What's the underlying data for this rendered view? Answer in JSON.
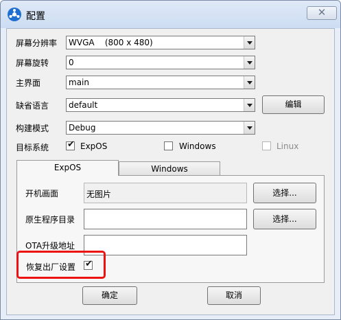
{
  "window": {
    "title": "配置",
    "close_glyph": "✕"
  },
  "form": {
    "resolution": {
      "label": "屏幕分辨率",
      "value": "WVGA    (800 x 480)"
    },
    "rotation": {
      "label": "屏幕旋转",
      "value": "0"
    },
    "main_ui": {
      "label": "主界面",
      "value": "main"
    },
    "language": {
      "label": "缺省语言",
      "value": "default",
      "edit_label": "编辑"
    },
    "build_mode": {
      "label": "构建模式",
      "value": "Debug"
    },
    "target_system": {
      "label": "目标系统",
      "options": [
        {
          "label": "ExpOS",
          "checked": true,
          "enabled": true
        },
        {
          "label": "Windows",
          "checked": false,
          "enabled": true
        },
        {
          "label": "Linux",
          "checked": false,
          "enabled": false
        }
      ]
    }
  },
  "tabs": [
    {
      "label": "ExpOS",
      "active": true
    },
    {
      "label": "Windows",
      "active": false
    }
  ],
  "expos_panel": {
    "boot_image": {
      "label": "开机画面",
      "value": "无图片",
      "button": "选择..."
    },
    "native_dir": {
      "label": "原生程序目录",
      "value": "",
      "button": "选择..."
    },
    "ota_url": {
      "label": "OTA升级地址",
      "value": ""
    },
    "factory_reset": {
      "label": "恢复出厂设置",
      "checked": true
    }
  },
  "buttons": {
    "ok": "确定",
    "cancel": "取消"
  },
  "colors": {
    "highlight": "#ee1111",
    "icon_blue": "#1f6fd0"
  },
  "check_glyph": "✔"
}
